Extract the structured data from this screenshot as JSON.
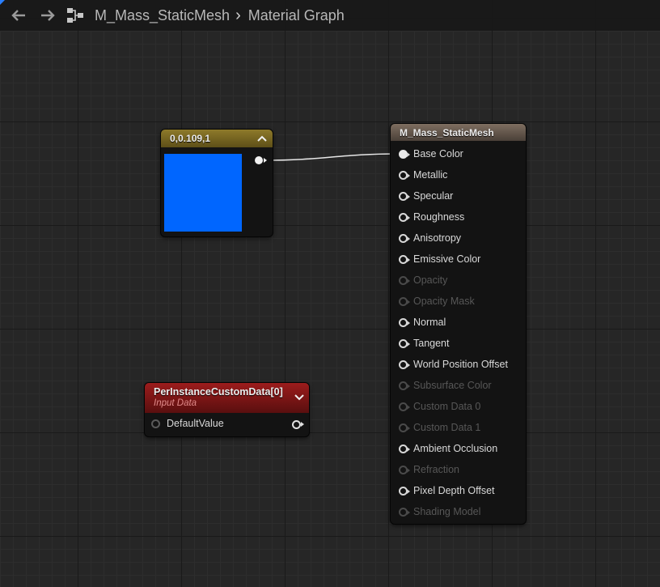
{
  "header": {
    "breadcrumb_root": "M_Mass_StaticMesh",
    "breadcrumb_separator": "›",
    "breadcrumb_current": "Material Graph",
    "icons": [
      "back-arrow-icon",
      "forward-arrow-icon",
      "graph-icon",
      "chevron-right-icon"
    ]
  },
  "constant_node": {
    "title": "0,0.109,1",
    "swatch_color": "#0066ff",
    "header_color": "#8a7526"
  },
  "custom_data_node": {
    "title": "PerInstanceCustomData[0]",
    "subtitle": "Input Data",
    "input_label": "DefaultValue",
    "header_color": "#8f1a1a"
  },
  "material_node": {
    "title": "M_Mass_StaticMesh",
    "pins": [
      {
        "label": "Base Color",
        "enabled": true,
        "connected": true
      },
      {
        "label": "Metallic",
        "enabled": true,
        "connected": false
      },
      {
        "label": "Specular",
        "enabled": true,
        "connected": false
      },
      {
        "label": "Roughness",
        "enabled": true,
        "connected": false
      },
      {
        "label": "Anisotropy",
        "enabled": true,
        "connected": false
      },
      {
        "label": "Emissive Color",
        "enabled": true,
        "connected": false
      },
      {
        "label": "Opacity",
        "enabled": false,
        "connected": false
      },
      {
        "label": "Opacity Mask",
        "enabled": false,
        "connected": false
      },
      {
        "label": "Normal",
        "enabled": true,
        "connected": false
      },
      {
        "label": "Tangent",
        "enabled": true,
        "connected": false
      },
      {
        "label": "World Position Offset",
        "enabled": true,
        "connected": false
      },
      {
        "label": "Subsurface Color",
        "enabled": false,
        "connected": false
      },
      {
        "label": "Custom Data 0",
        "enabled": false,
        "connected": false
      },
      {
        "label": "Custom Data 1",
        "enabled": false,
        "connected": false
      },
      {
        "label": "Ambient Occlusion",
        "enabled": true,
        "connected": false
      },
      {
        "label": "Refraction",
        "enabled": false,
        "connected": false
      },
      {
        "label": "Pixel Depth Offset",
        "enabled": true,
        "connected": false
      },
      {
        "label": "Shading Model",
        "enabled": false,
        "connected": false
      }
    ]
  }
}
